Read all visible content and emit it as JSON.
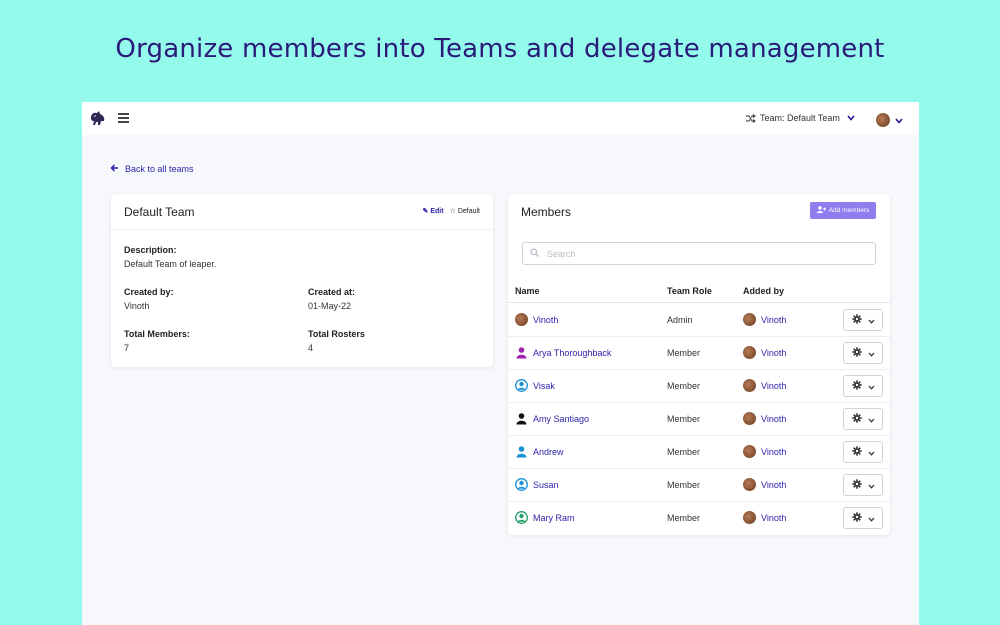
{
  "headline": "Organize members into Teams and delegate management",
  "topbar": {
    "team_switch_label": "Team: Default Team"
  },
  "back_link": "Back to all teams",
  "team": {
    "title": "Default Team",
    "edit_label": "Edit",
    "default_label": "Default",
    "description_label": "Description:",
    "description_value": "Default Team of leaper.",
    "created_by_label": "Created by:",
    "created_by_value": "Vinoth",
    "created_at_label": "Created at:",
    "created_at_value": "01-May-22",
    "total_members_label": "Total Members:",
    "total_members_value": "7",
    "total_rosters_label": "Total Rosters",
    "total_rosters_value": "4"
  },
  "members": {
    "title": "Members",
    "add_button": "Add members",
    "search_placeholder": "Search",
    "columns": [
      "Name",
      "Team Role",
      "Added by"
    ],
    "rows": [
      {
        "name": "Vinoth",
        "role": "Admin",
        "added_by": "Vinoth",
        "avatar": "photo"
      },
      {
        "name": "Arya Thoroughback",
        "role": "Member",
        "added_by": "Vinoth",
        "avatar": "user-icon",
        "color": "#a020b0"
      },
      {
        "name": "Visak",
        "role": "Member",
        "added_by": "Vinoth",
        "avatar": "user-circle-icon",
        "color": "#1a8fd8"
      },
      {
        "name": "Amy Santiago",
        "role": "Member",
        "added_by": "Vinoth",
        "avatar": "user-icon",
        "color": "#111111"
      },
      {
        "name": "Andrew",
        "role": "Member",
        "added_by": "Vinoth",
        "avatar": "user-icon",
        "color": "#1a8fd8"
      },
      {
        "name": "Susan",
        "role": "Member",
        "added_by": "Vinoth",
        "avatar": "user-circle-icon",
        "color": "#1a8fd8"
      },
      {
        "name": "Mary Ram",
        "role": "Member",
        "added_by": "Vinoth",
        "avatar": "user-circle-icon",
        "color": "#22a06b"
      }
    ]
  },
  "colors": {
    "background": "#94faeb",
    "accent": "#2a1fa8",
    "button": "#8f7ef0"
  }
}
